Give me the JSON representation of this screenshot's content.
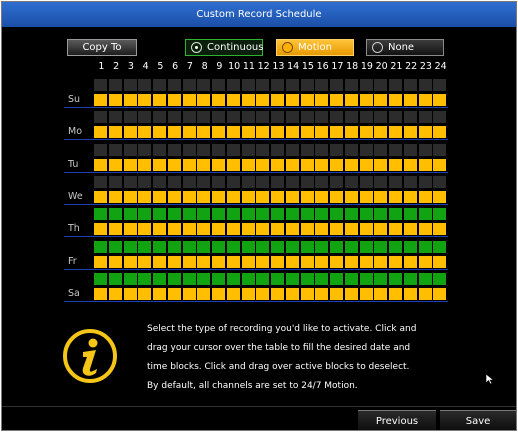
{
  "window": {
    "title": "Custom Record Schedule"
  },
  "toolbar": {
    "copy_to_label": "Copy To",
    "modes": [
      {
        "id": "continuous",
        "label": "Continuous",
        "selected": false
      },
      {
        "id": "motion",
        "label": "Motion",
        "selected": true
      },
      {
        "id": "none",
        "label": "None",
        "selected": false
      }
    ]
  },
  "hours": [
    "1",
    "2",
    "3",
    "4",
    "5",
    "6",
    "7",
    "8",
    "9",
    "10",
    "11",
    "12",
    "13",
    "14",
    "15",
    "16",
    "17",
    "18",
    "19",
    "20",
    "21",
    "22",
    "23",
    "24"
  ],
  "days": [
    {
      "label": "Su",
      "upper": "none",
      "lower": "motion"
    },
    {
      "label": "Mo",
      "upper": "none",
      "lower": "motion"
    },
    {
      "label": "Tu",
      "upper": "none",
      "lower": "motion"
    },
    {
      "label": "We",
      "upper": "none",
      "lower": "motion"
    },
    {
      "label": "Th",
      "upper": "continuous",
      "lower": "motion"
    },
    {
      "label": "Fr",
      "upper": "continuous",
      "lower": "motion"
    },
    {
      "label": "Sa",
      "upper": "continuous",
      "lower": "motion"
    }
  ],
  "colors": {
    "motion": "#ffbf00",
    "continuous": "#12a312",
    "none": "#2c2c2c",
    "title_bar": "#2565c0"
  },
  "info": {
    "icon": "info-icon",
    "lines": [
      "Select the type of recording you'd like to activate. Click and",
      "drag your cursor over the table to fill the desired date and",
      "time blocks. Click and drag over active blocks to deselect.",
      "By default, all channels are set to 24/7 Motion."
    ]
  },
  "footer": {
    "previous_label": "Previous",
    "save_label": "Save"
  }
}
